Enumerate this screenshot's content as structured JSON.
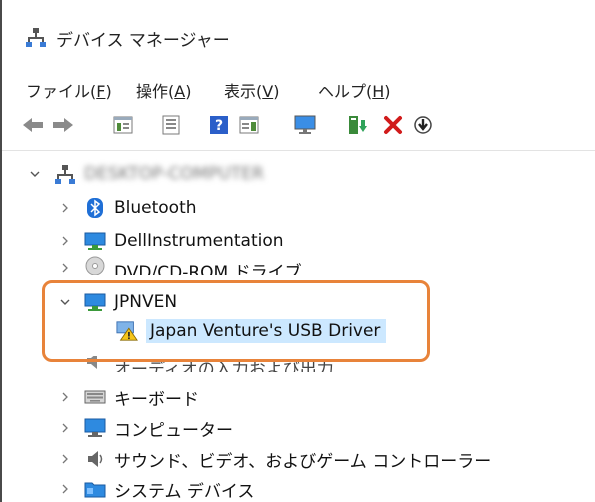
{
  "window": {
    "title": "デバイス マネージャー"
  },
  "menu": {
    "items": [
      {
        "label": "ファイル(",
        "accel": "F",
        "suffix": ")"
      },
      {
        "label": "操作(",
        "accel": "A",
        "suffix": ")"
      },
      {
        "label": "表示(",
        "accel": "V",
        "suffix": ")"
      },
      {
        "label": "ヘルプ(",
        "accel": "H",
        "suffix": ")"
      }
    ]
  },
  "toolbar": {
    "buttons": [
      "back-icon",
      "forward-icon",
      "properties-icon",
      "show-hide-console-tree-icon",
      "help-icon",
      "action-pane-icon",
      "monitor-icon",
      "update-driver-icon",
      "uninstall-icon",
      "scan-hardware-icon"
    ]
  },
  "tree": {
    "root": {
      "label": "DESKTOP-COMPUTER",
      "expanded": true
    },
    "items": [
      {
        "label": "Bluetooth",
        "icon": "bluetooth-icon"
      },
      {
        "label": "DellInstrumentation",
        "icon": "computer-icon"
      },
      {
        "label": "DVD/CD-ROM ドライブ",
        "icon": "disc-drive-icon"
      },
      {
        "label": "JPNVEN",
        "icon": "computer-icon",
        "expanded": true
      },
      {
        "label": "Japan Venture's USB Driver",
        "icon": "warning-device-icon",
        "selected": true
      },
      {
        "label": "オーディオの入力および出力",
        "icon": "audio-icon"
      },
      {
        "label": "キーボード",
        "icon": "keyboard-icon"
      },
      {
        "label": "コンピューター",
        "icon": "monitor-icon"
      },
      {
        "label": "サウンド、ビデオ、およびゲーム コントローラー",
        "icon": "speaker-icon"
      },
      {
        "label": "システム デバイス",
        "icon": "folder-icon"
      }
    ]
  },
  "colors": {
    "selection": "#cce8ff",
    "highlight": "#e8833a",
    "accent": "#0078d7",
    "error": "#d11b1b"
  }
}
